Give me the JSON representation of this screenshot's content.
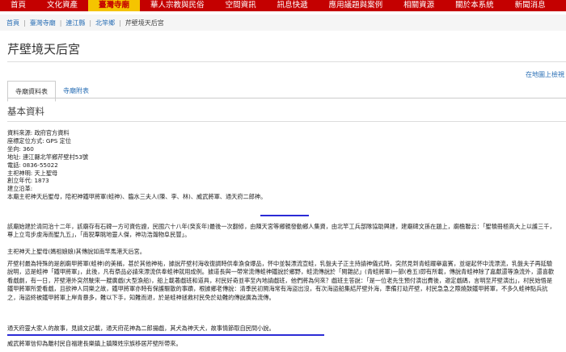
{
  "nav": [
    "首頁",
    "文化資產",
    "臺灣寺廟",
    "華人宗教與民俗",
    "空間資訊",
    "訊息快遞",
    "應用議題與案例",
    "相關資源",
    "關於本系統",
    "新聞消息"
  ],
  "breadcrumb": [
    "首頁",
    "臺灣寺廟",
    "連江縣",
    "北竿鄉",
    "芹壁境天后宮"
  ],
  "page_title": "芹壁境天后宮",
  "map_link": "在地圖上檢視",
  "tabs": [
    "寺廟資料表",
    "寺廟附表"
  ],
  "section_title": "基本資料",
  "info": {
    "source": "資料來源: 政府官方資料",
    "coord": "座標定位方式: GPS 定位",
    "id": "坐向: 360",
    "address": "地址: 連江縣北竿鄉芹壁村53號",
    "phone": "電話: 0836-55022",
    "deity": "主祀神明: 天上聖母",
    "founded": "創立年代: 1873",
    "history_label": "建立沿革:",
    "history_line": "本廟主祀神天后聖母，陪祀神鐵甲將軍(蛙神)、臨水三夫人(陳、李、林)、威武將軍、通天府二郎神。"
  },
  "paragraphs": [
    "該廟始建於清同治十二年，該廟存有石碑一方可資佐證，民國六十八年(癸亥年)最後一次翻修，由陳天宮等鄉親發動鄉人集資，由北竿工兵部隊協助興建，建廟碑文孫在題上，廟檐聯云：「聖犢冊極高大上以護三千，尊上立弯步虔海而聖九五」，「南猊羣眺地靈人傑，神功浩瀚物阜民豐」。",
    "主祀神天上聖母(媽祖娘娘)其傳說如南竿馬港天后宮。",
    "芹壁村最為特殊的是創廟甲將軍(蛙神)的美稱，甚於其他神祐，據說芹壁村海收復調時供奉漁食爆品，怀中並製漂流宣蛙，乳盤夫子正主持請神儀式時，突然見到青蛙躍舉嘉賓，並堤起怀中流漂流，乳盤夫子再延驗說明，這是蛙神「鐵甲將軍」，此後，凡有祭品必請來漂流供奉蛙神就用成例。據道長與一帶常流傳蛙神鐵說於鄉野，蛙流傳說於「閩雜記」(青蛙將軍)一節(卷五)即有所載，傳說青蛙神除了嘉獻還等漁流外，還喜歡看戲劇，有一日，芹壁港外突然駛來一艘廣戲(大型漁船)，船上載著戲班和道具，村民好奇並率至內地請戲班，他們將為何來？戲班主答說：「是一位老先生預付演出費後，邀定戲碼，言明至芹壁演出」，村民始悟是鐵甲將軍所愛看戲，且欲神人同樂之故，鐵甲將軍亦時有保護驅散的事蹟，根據鄉老傳說：清季民初閩海常有海盜出沒，有次海盜船集結芹壁外海，準備打劫芹壁，村民急急之際燒鼓鐵甲將軍，不多久蛙神點兵抗之，海盜終被鐵甲將軍上岸青暴多，難以下手，知難而退，於是蛙神拯救村民免於劫難的傳說廣為流傳。",
    "通天府靈大家人的故事，見請文記載，通天府花神為二郎揚戲，其犬為神天犬，故事情節取自民間小說。",
    "威武將軍信仰為離村民自福建長樂鎮上鎮陳姓宗族移居芹壁所帶來。"
  ]
}
